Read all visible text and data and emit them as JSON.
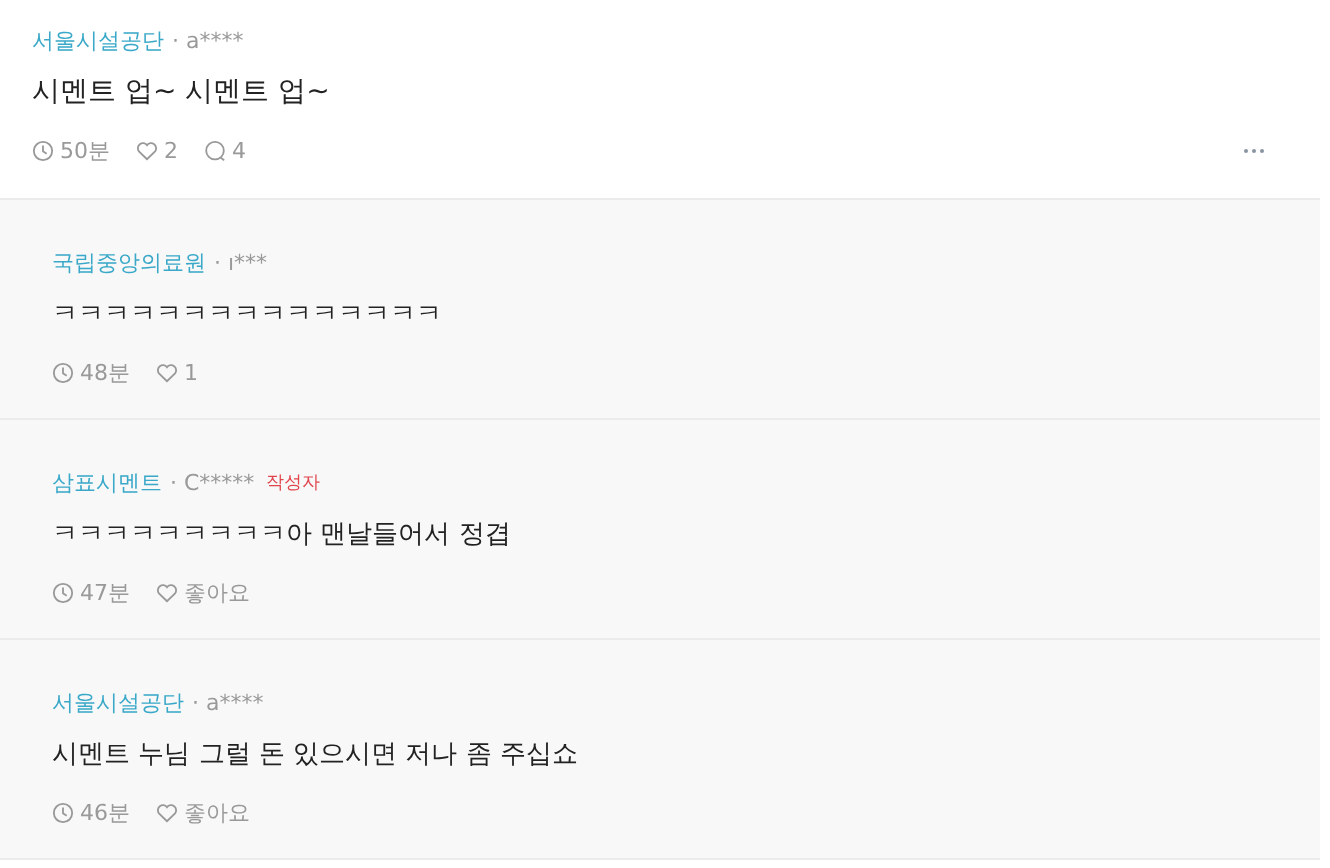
{
  "post": {
    "company": "서울시설공단",
    "user": "· a****",
    "text": "시멘트 업~ 시멘트 업~",
    "time": "50분",
    "likes": "2",
    "comments": "4"
  },
  "replies": [
    {
      "company": "국립중앙의료원",
      "user": "· ı***",
      "text": "ㅋㅋㅋㅋㅋㅋㅋㅋㅋㅋㅋㅋㅋㅋㅋ",
      "time": "48분",
      "likes": "1"
    },
    {
      "company": "삼표시멘트",
      "user": "· C*****",
      "badge": "작성자",
      "text": "ㅋㅋㅋㅋㅋㅋㅋㅋㅋ아 맨날들어서 정겹",
      "time": "47분",
      "likes": "좋아요"
    },
    {
      "company": "서울시설공단",
      "user": "· a****",
      "text": "시멘트 누님 그럴 돈 있으시면 저나 좀 주십쇼",
      "time": "46분",
      "likes": "좋아요"
    }
  ]
}
